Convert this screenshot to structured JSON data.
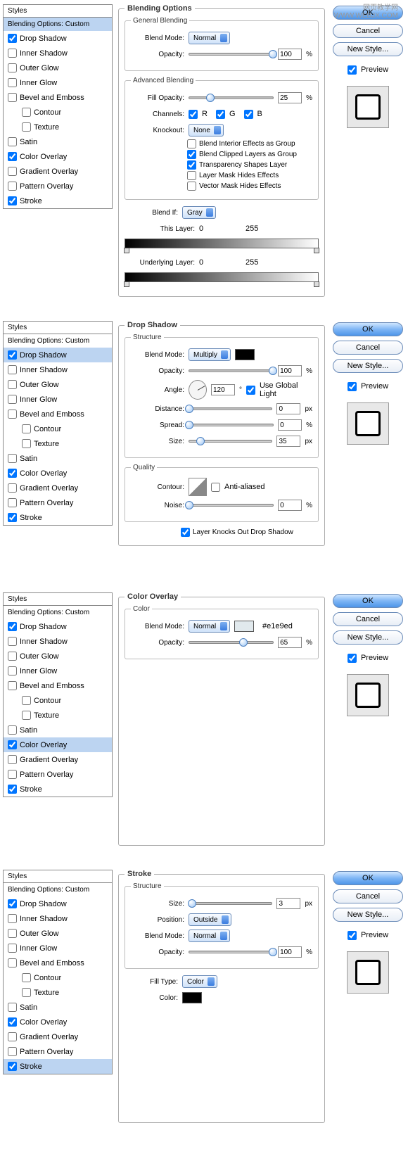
{
  "watermark": {
    "line1": "网页教学网",
    "line2": "WWW.WEBJX.COM"
  },
  "styles_list": {
    "header": "Styles",
    "options_header": "Blending Options: Custom",
    "items": [
      {
        "label": "Drop Shadow",
        "checked": true
      },
      {
        "label": "Inner Shadow",
        "checked": false
      },
      {
        "label": "Outer Glow",
        "checked": false
      },
      {
        "label": "Inner Glow",
        "checked": false
      },
      {
        "label": "Bevel and Emboss",
        "checked": false
      },
      {
        "label": "Contour",
        "checked": false,
        "indent": true
      },
      {
        "label": "Texture",
        "checked": false,
        "indent": true
      },
      {
        "label": "Satin",
        "checked": false
      },
      {
        "label": "Color Overlay",
        "checked": true
      },
      {
        "label": "Gradient Overlay",
        "checked": false
      },
      {
        "label": "Pattern Overlay",
        "checked": false
      },
      {
        "label": "Stroke",
        "checked": true
      }
    ]
  },
  "buttons": {
    "ok": "OK",
    "cancel": "Cancel",
    "new_style": "New Style...",
    "preview": "Preview"
  },
  "panel1": {
    "title": "Blending Options",
    "general_legend": "General Blending",
    "blend_mode_label": "Blend Mode:",
    "blend_mode_value": "Normal",
    "opacity_label": "Opacity:",
    "opacity_value": "100",
    "opacity_unit": "%",
    "advanced_legend": "Advanced Blending",
    "fill_opacity_label": "Fill Opacity:",
    "fill_opacity_value": "25",
    "fill_opacity_unit": "%",
    "channels_label": "Channels:",
    "ch_r": "R",
    "ch_g": "G",
    "ch_b": "B",
    "knockout_label": "Knockout:",
    "knockout_value": "None",
    "adv_checks": [
      {
        "label": "Blend Interior Effects as Group",
        "checked": false
      },
      {
        "label": "Blend Clipped Layers as Group",
        "checked": true
      },
      {
        "label": "Transparency Shapes Layer",
        "checked": true
      },
      {
        "label": "Layer Mask Hides Effects",
        "checked": false
      },
      {
        "label": "Vector Mask Hides Effects",
        "checked": false
      }
    ],
    "blend_if_label": "Blend If:",
    "blend_if_value": "Gray",
    "this_layer_label": "This Layer:",
    "this_layer_lo": "0",
    "this_layer_hi": "255",
    "underlying_label": "Underlying Layer:",
    "underlying_lo": "0",
    "underlying_hi": "255",
    "selected": "Blending Options: Custom"
  },
  "panel2": {
    "title": "Drop Shadow",
    "structure_legend": "Structure",
    "blend_mode_label": "Blend Mode:",
    "blend_mode_value": "Multiply",
    "swatch_color": "#000000",
    "opacity_label": "Opacity:",
    "opacity_value": "100",
    "opacity_unit": "%",
    "angle_label": "Angle:",
    "angle_value": "120",
    "angle_unit": "°",
    "use_global_light": "Use Global Light",
    "distance_label": "Distance:",
    "distance_value": "0",
    "distance_unit": "px",
    "spread_label": "Spread:",
    "spread_value": "0",
    "spread_unit": "%",
    "size_label": "Size:",
    "size_value": "35",
    "size_unit": "px",
    "quality_legend": "Quality",
    "contour_label": "Contour:",
    "anti_aliased": "Anti-aliased",
    "noise_label": "Noise:",
    "noise_value": "0",
    "noise_unit": "%",
    "layer_knocks": "Layer Knocks Out Drop Shadow",
    "selected": "Drop Shadow"
  },
  "panel3": {
    "title": "Color Overlay",
    "color_legend": "Color",
    "blend_mode_label": "Blend Mode:",
    "blend_mode_value": "Normal",
    "swatch_color": "#e1e9ed",
    "swatch_hex": "#e1e9ed",
    "opacity_label": "Opacity:",
    "opacity_value": "65",
    "opacity_unit": "%",
    "selected": "Color Overlay"
  },
  "panel4": {
    "title": "Stroke",
    "structure_legend": "Structure",
    "size_label": "Size:",
    "size_value": "3",
    "size_unit": "px",
    "position_label": "Position:",
    "position_value": "Outside",
    "blend_mode_label": "Blend Mode:",
    "blend_mode_value": "Normal",
    "opacity_label": "Opacity:",
    "opacity_value": "100",
    "opacity_unit": "%",
    "fill_type_label": "Fill Type:",
    "fill_type_value": "Color",
    "color_label": "Color:",
    "swatch_color": "#000000",
    "selected": "Stroke"
  }
}
